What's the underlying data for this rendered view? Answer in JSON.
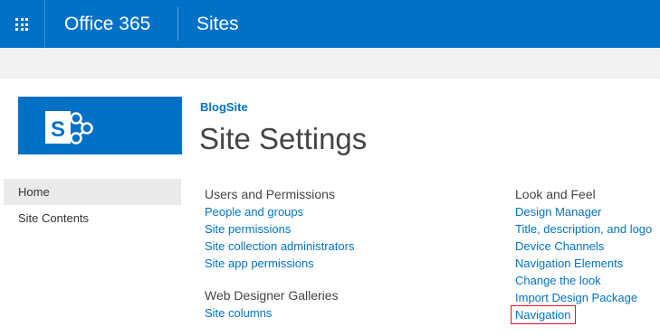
{
  "suite_bar": {
    "brand": "Office 365",
    "app_title": "Sites",
    "waffle_icon": "app-launcher-icon",
    "accent": "#0072c6"
  },
  "site": {
    "breadcrumb": "BlogSite",
    "page_title": "Site Settings",
    "logo_icon": "sharepoint-logo-icon"
  },
  "quick_launch": {
    "items": [
      {
        "label": "Home",
        "selected": true
      },
      {
        "label": "Site Contents",
        "selected": false
      }
    ]
  },
  "settings": {
    "users_permissions": {
      "title": "Users and Permissions",
      "links": [
        "People and groups",
        "Site permissions",
        "Site collection administrators",
        "Site app permissions"
      ]
    },
    "web_designer_galleries": {
      "title": "Web Designer Galleries",
      "links": [
        "Site columns"
      ]
    },
    "look_and_feel": {
      "title": "Look and Feel",
      "links": [
        "Design Manager",
        "Title, description, and logo",
        "Device Channels",
        "Navigation Elements",
        "Change the look",
        "Import Design Package",
        "Navigation"
      ]
    }
  },
  "highlight_color": "#e81123"
}
